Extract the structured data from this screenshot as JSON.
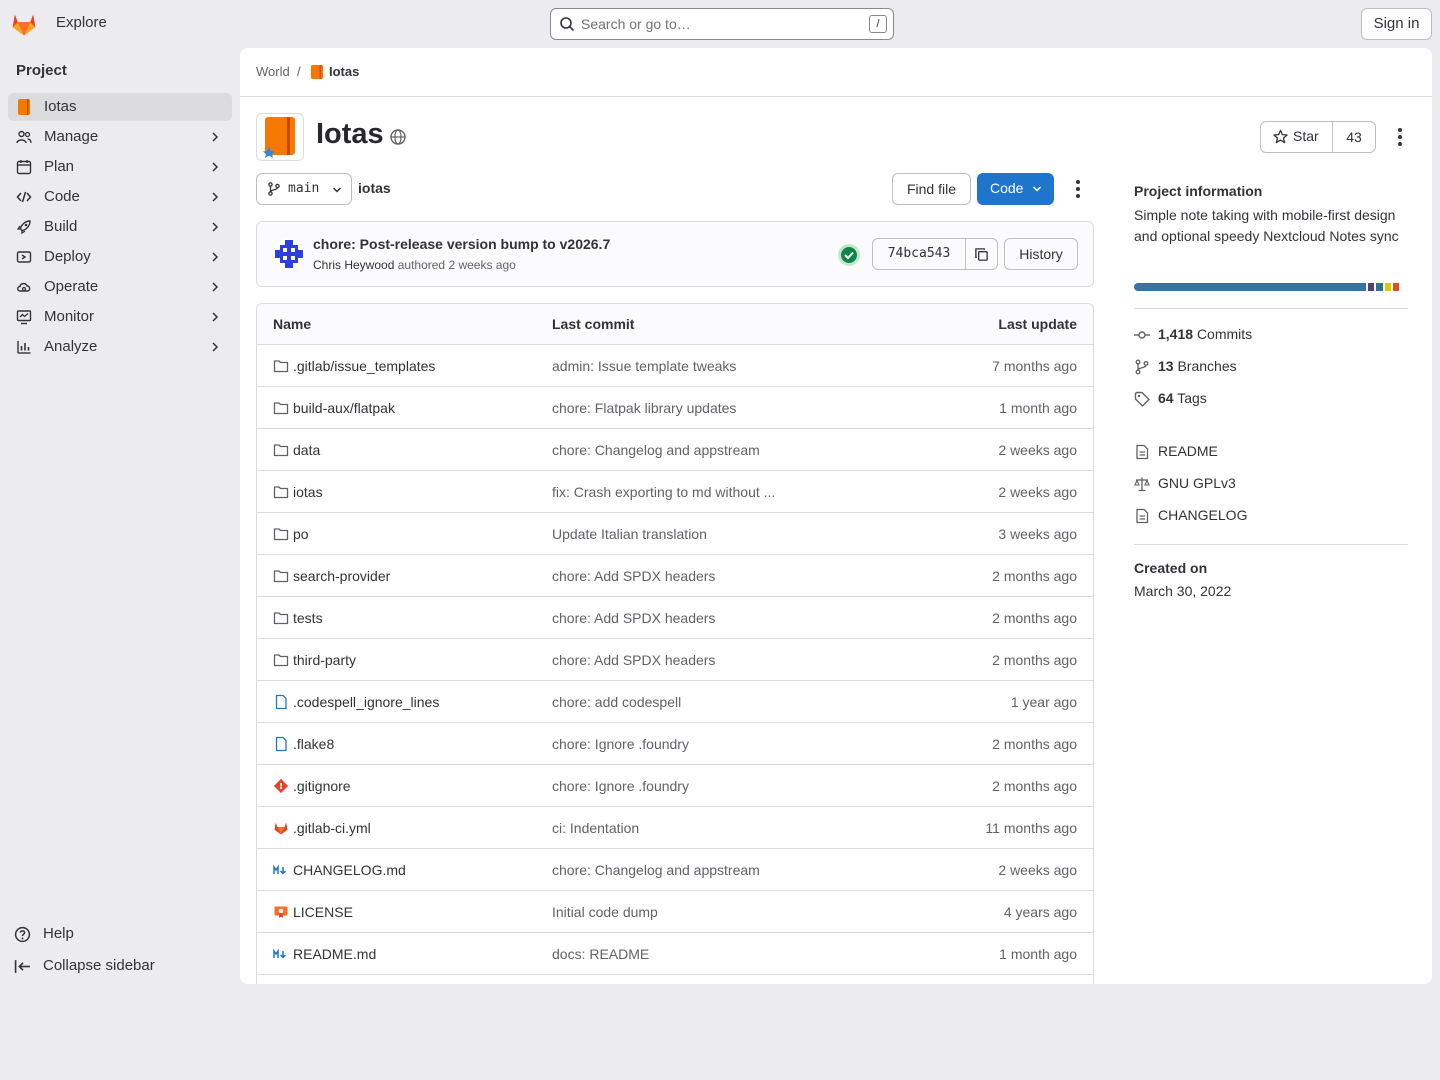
{
  "topbar": {
    "explore_label": "Explore",
    "search_placeholder": "Search or go to…",
    "search_shortcut": "/",
    "signin_label": "Sign in"
  },
  "sidebar": {
    "section_title": "Project",
    "items": [
      {
        "label": "Iotas",
        "icon": "project-avatar-icon",
        "active": true
      },
      {
        "label": "Manage",
        "icon": "users-icon"
      },
      {
        "label": "Plan",
        "icon": "planning-icon"
      },
      {
        "label": "Code",
        "icon": "code-icon"
      },
      {
        "label": "Build",
        "icon": "rocket-icon"
      },
      {
        "label": "Deploy",
        "icon": "deployments-icon"
      },
      {
        "label": "Operate",
        "icon": "cloud-gear-icon"
      },
      {
        "label": "Monitor",
        "icon": "monitor-icon"
      },
      {
        "label": "Analyze",
        "icon": "chart-icon"
      }
    ],
    "help_label": "Help",
    "collapse_label": "Collapse sidebar"
  },
  "breadcrumb": {
    "group": "World",
    "separator": "/",
    "project": "Iotas"
  },
  "project": {
    "name": "Iotas",
    "star_label": "Star",
    "star_count": "43"
  },
  "repo": {
    "branch": "main",
    "path": "iotas",
    "find_file_label": "Find file",
    "code_label": "Code"
  },
  "commit": {
    "title": "chore: Post-release version bump to v2026.7",
    "author": "Chris Heywood",
    "action": "authored",
    "time": "2 weeks ago",
    "sha": "74bca543",
    "history_label": "History",
    "pipeline_status": "passed"
  },
  "tree": {
    "headers": {
      "name": "Name",
      "last_commit": "Last commit",
      "last_update": "Last update"
    },
    "rows": [
      {
        "name": ".gitlab/issue_templates",
        "type": "folder",
        "msg": "admin: Issue template tweaks",
        "date": "7 months ago"
      },
      {
        "name": "build-aux/flatpak",
        "type": "folder",
        "msg": "chore: Flatpak library updates",
        "date": "1 month ago"
      },
      {
        "name": "data",
        "type": "folder",
        "msg": "chore: Changelog and appstream",
        "date": "2 weeks ago"
      },
      {
        "name": "iotas",
        "type": "folder",
        "msg": "fix: Crash exporting to md without ...",
        "date": "2 weeks ago"
      },
      {
        "name": "po",
        "type": "folder",
        "msg": "Update Italian translation",
        "date": "3 weeks ago"
      },
      {
        "name": "search-provider",
        "type": "folder",
        "msg": "chore: Add SPDX headers",
        "date": "2 months ago"
      },
      {
        "name": "tests",
        "type": "folder",
        "msg": "chore: Add SPDX headers",
        "date": "2 months ago"
      },
      {
        "name": "third-party",
        "type": "folder",
        "msg": "chore: Add SPDX headers",
        "date": "2 months ago"
      },
      {
        "name": ".codespell_ignore_lines",
        "type": "file",
        "msg": "chore: add codespell",
        "date": "1 year ago"
      },
      {
        "name": ".flake8",
        "type": "file",
        "msg": "chore: Ignore .foundry",
        "date": "2 months ago"
      },
      {
        "name": ".gitignore",
        "type": "git",
        "msg": "chore: Ignore .foundry",
        "date": "2 months ago"
      },
      {
        "name": ".gitlab-ci.yml",
        "type": "gitlab",
        "msg": "ci: Indentation",
        "date": "11 months ago"
      },
      {
        "name": "CHANGELOG.md",
        "type": "markdown",
        "msg": "chore: Changelog and appstream",
        "date": "2 weeks ago"
      },
      {
        "name": "LICENSE",
        "type": "license",
        "msg": "Initial code dump",
        "date": "4 years ago"
      },
      {
        "name": "README.md",
        "type": "markdown",
        "msg": "docs: README",
        "date": "1 month ago"
      }
    ]
  },
  "info": {
    "title": "Project information",
    "description": "Simple note taking with mobile-first design and optional speedy Nextcloud Notes sync",
    "languages": [
      {
        "color": "#3572a5",
        "fraction": 0.855
      },
      {
        "color": "#563d7c",
        "fraction": 0.03
      },
      {
        "color": "#89e051",
        "fraction": 0.0
      },
      {
        "color": "#2b7489",
        "fraction": 0.03
      },
      {
        "color": "#e0c800",
        "fraction": 0.03
      },
      {
        "color": "#e34c26",
        "fraction": 0.03
      }
    ],
    "commits_count": "1,418",
    "commits_label": "Commits",
    "branches_count": "13",
    "branches_label": "Branches",
    "tags_count": "64",
    "tags_label": "Tags",
    "readme_label": "README",
    "license_label": "GNU GPLv3",
    "changelog_label": "CHANGELOG",
    "created_label": "Created on",
    "created_value": "March 30, 2022"
  }
}
